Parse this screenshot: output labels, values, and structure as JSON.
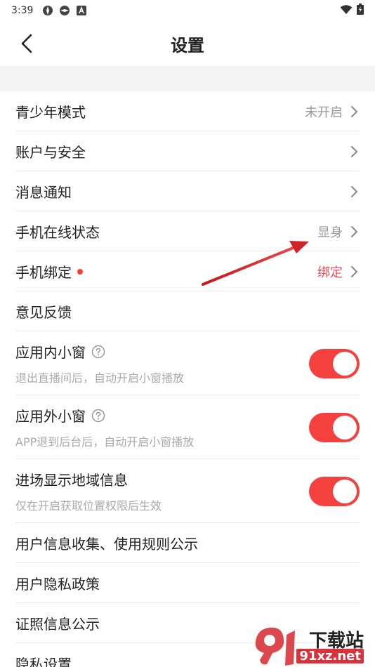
{
  "status_bar": {
    "time": "3:39"
  },
  "header": {
    "title": "设置"
  },
  "rows": [
    {
      "label": "青少年模式",
      "value": "未开启"
    },
    {
      "label": "账户与安全"
    },
    {
      "label": "消息通知"
    },
    {
      "label": "手机在线状态",
      "value": "显身"
    },
    {
      "label": "手机绑定",
      "value": "绑定"
    },
    {
      "label": "意见反馈"
    }
  ],
  "toggles": [
    {
      "label": "应用内小窗",
      "subtitle": "退出直播间后，自动开启小窗播放",
      "enabled": true
    },
    {
      "label": "应用外小窗",
      "subtitle": "APP退到后台后，自动开启小窗播放",
      "enabled": true
    },
    {
      "label": "进场显示地域信息",
      "subtitle": "仅在开启获取位置权限后生效",
      "enabled": true
    }
  ],
  "links": [
    {
      "label": "用户信息收集、使用规则公示"
    },
    {
      "label": "用户隐私政策"
    },
    {
      "label": "证照信息公示"
    },
    {
      "label": "隐私设置"
    }
  ],
  "watermark": {
    "brand": "下载站",
    "domain": "91xz.net"
  },
  "colors": {
    "accent": "#f5413e",
    "value_gray": "#999999",
    "bind_red": "#ef4a55",
    "band": "#f4f4f4"
  }
}
